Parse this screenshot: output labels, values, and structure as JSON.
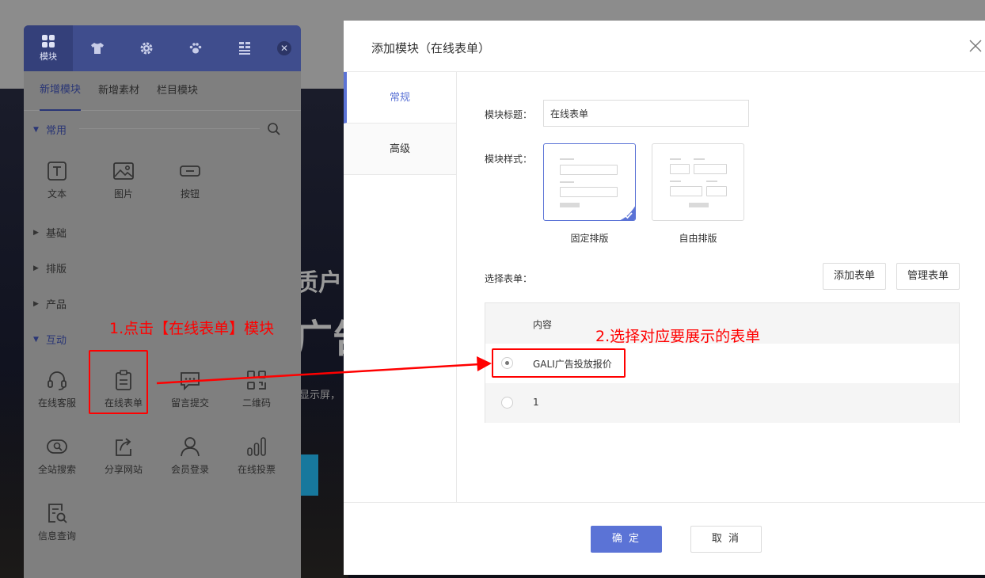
{
  "background": {
    "hero_title_1": "质户",
    "hero_title_2": "广告",
    "hero_subtitle": "显示屏，"
  },
  "panel": {
    "tabs": [
      {
        "icon": "modules-icon",
        "label": "模块"
      },
      {
        "icon": "shirt-icon",
        "label": ""
      },
      {
        "icon": "gear-icon",
        "label": ""
      },
      {
        "icon": "paw-icon",
        "label": ""
      },
      {
        "icon": "list-icon",
        "label": ""
      }
    ],
    "close_icon": "close-icon",
    "subtabs": [
      "新增模块",
      "新增素材",
      "栏目模块"
    ],
    "categories": {
      "common": "常用",
      "basic": "基础",
      "layout": "排版",
      "product": "产品",
      "interaction": "互动"
    },
    "common_modules": [
      {
        "icon": "text-icon",
        "label": "文本"
      },
      {
        "icon": "image-icon",
        "label": "图片"
      },
      {
        "icon": "button-icon",
        "label": "按钮"
      }
    ],
    "interaction_modules": [
      {
        "icon": "headset-icon",
        "label": "在线客服"
      },
      {
        "icon": "clipboard-icon",
        "label": "在线表单"
      },
      {
        "icon": "message-icon",
        "label": "留言提交"
      },
      {
        "icon": "qrcode-icon",
        "label": "二维码"
      },
      {
        "icon": "site-search-icon",
        "label": "全站搜索"
      },
      {
        "icon": "share-icon",
        "label": "分享网站"
      },
      {
        "icon": "user-icon",
        "label": "会员登录"
      },
      {
        "icon": "bar-chart-icon",
        "label": "在线投票"
      },
      {
        "icon": "doc-search-icon",
        "label": "信息查询"
      }
    ]
  },
  "dialog": {
    "title": "添加模块（在线表单）",
    "side_tabs": [
      "常规",
      "高级"
    ],
    "module_title_label": "模块标题：",
    "module_title_value": "在线表单",
    "module_style_label": "模块样式：",
    "styles": [
      {
        "label": "固定排版",
        "selected": true
      },
      {
        "label": "自由排版",
        "selected": false
      }
    ],
    "select_form_label": "选择表单：",
    "add_form_button": "添加表单",
    "manage_form_button": "管理表单",
    "table_header": "内容",
    "forms": [
      {
        "name": "GALI广告投放报价",
        "selected": true
      },
      {
        "name": "1",
        "selected": false
      }
    ],
    "confirm_button": "确 定",
    "cancel_button": "取 消"
  },
  "annotations": {
    "step1": "1.点击【在线表单】模块",
    "step2": "2.选择对应要展示的表单",
    "color": "#ff0000"
  },
  "colors": {
    "primary": "#5b73d6",
    "panel_header": "#3f4d8d"
  }
}
